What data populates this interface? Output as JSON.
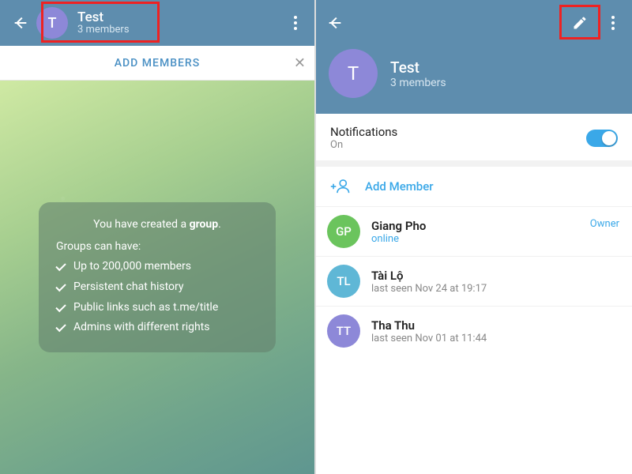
{
  "left": {
    "avatar_letter": "T",
    "group_name": "Test",
    "members_sub": "3 members",
    "add_members_label": "ADD MEMBERS",
    "card": {
      "title_pre": "You have created a ",
      "title_bold": "group",
      "title_post": ".",
      "subtitle": "Groups can have:",
      "features": [
        "Up to 200,000 members",
        "Persistent chat history",
        "Public links such as t.me/title",
        "Admins with different rights"
      ]
    }
  },
  "right": {
    "avatar_letter": "T",
    "group_name": "Test",
    "members_sub": "3 members",
    "notifications": {
      "label": "Notifications",
      "value": "On"
    },
    "add_member_label": "Add Member",
    "members": [
      {
        "initials": "GP",
        "name": "Giang Pho",
        "status": "online",
        "status_online": true,
        "role": "Owner",
        "avatar_color": "#6bc45d"
      },
      {
        "initials": "TL",
        "name": "Tài Lộ",
        "status": "last seen Nov 24 at 19:17",
        "status_online": false,
        "role": "",
        "avatar_color": "#5fb7d6"
      },
      {
        "initials": "TT",
        "name": "Tha Thu",
        "status": "last seen Nov 01 at 11:44",
        "status_online": false,
        "role": "",
        "avatar_color": "#8d88d8"
      }
    ]
  }
}
